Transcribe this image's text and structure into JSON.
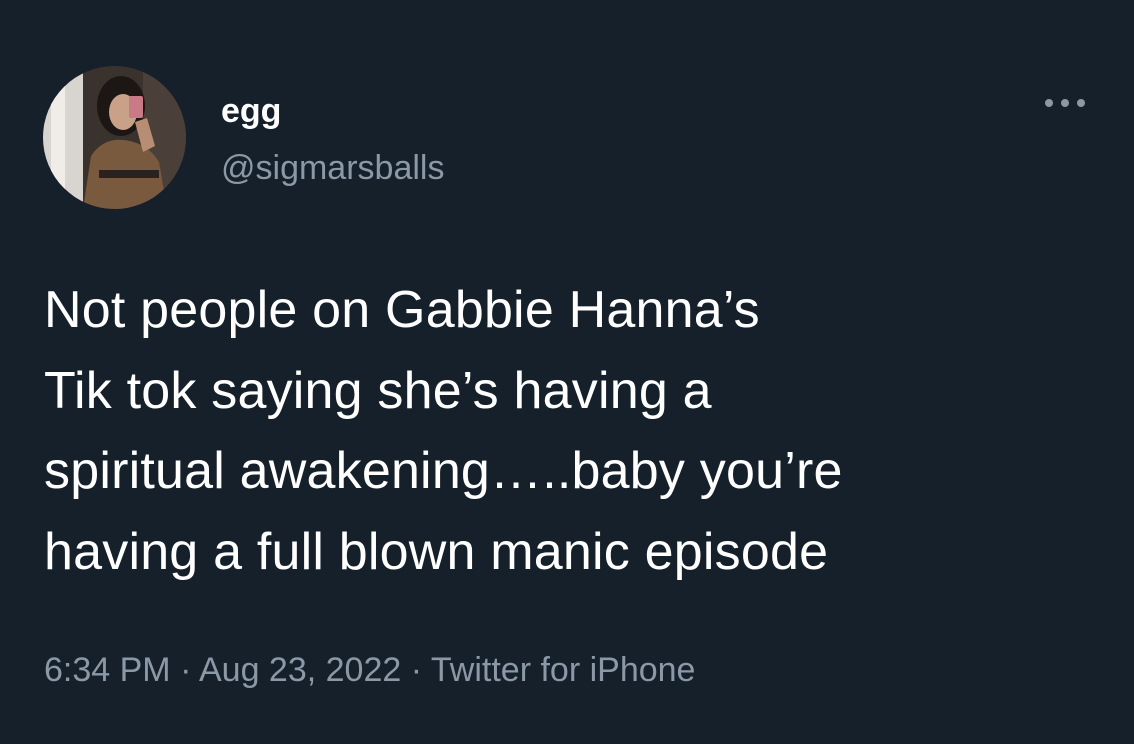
{
  "tweet": {
    "author": {
      "name": "egg",
      "handle": "@sigmarsballs"
    },
    "text": "Not people on Gabbie Hanna’s\nTik tok saying she’s having a\nspiritual awakening…..baby you’re\nhaving a full blown manic episode",
    "time": "6:34 PM",
    "separator": "·",
    "date": "Aug 23, 2022",
    "source": "Twitter for iPhone",
    "more_icon": "more-horizontal-icon"
  },
  "colors": {
    "background": "#15202b",
    "text_primary": "#ffffff",
    "text_secondary": "#8b98a5"
  }
}
